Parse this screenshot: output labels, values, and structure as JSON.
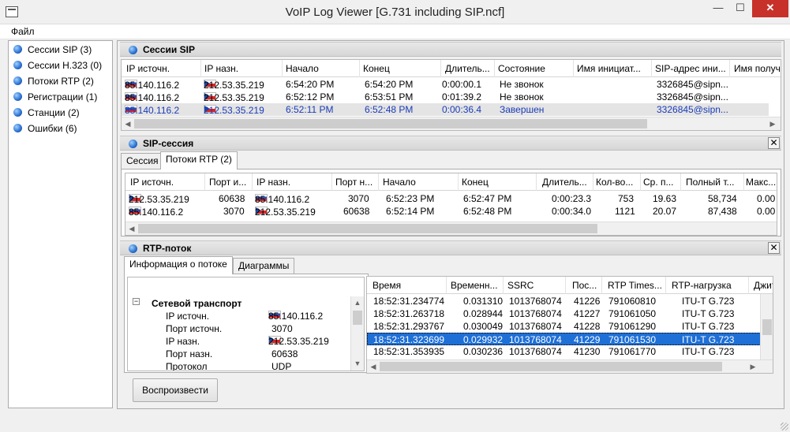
{
  "window": {
    "title": "VoIP Log Viewer [G.731 including SIP.ncf]",
    "min_glyph": "—",
    "max_glyph": "☐",
    "close_glyph": "✕"
  },
  "menu": {
    "file": "Файл"
  },
  "nav": [
    {
      "label": "Сессии SIP  (3)"
    },
    {
      "label": "Сессии H.323 (0)"
    },
    {
      "label": "Потоки RTP (2)"
    },
    {
      "label": "Регистрации (1)"
    },
    {
      "label": "Станции (2)"
    },
    {
      "label": "Ошибки (6)"
    }
  ],
  "sip_sessions": {
    "title": "Сессии SIP",
    "columns": [
      "IP источн.",
      "IP назн.",
      "Начало",
      "Конец",
      "Длитель...",
      "Состояние",
      "Имя инициат...",
      "SIP-адрес ини...",
      "Имя получ"
    ],
    "rows": [
      {
        "src": "85.140.116.2",
        "dst": "212.53.35.219",
        "start": "6:54:20 PM",
        "end": "6:54:20 PM",
        "dur": "0:00:00.1",
        "state": "Не звонок",
        "name": "",
        "sip": "3326845@sipn..."
      },
      {
        "src": "85.140.116.2",
        "dst": "212.53.35.219",
        "start": "6:52:12 PM",
        "end": "6:53:51 PM",
        "dur": "0:01:39.2",
        "state": "Не звонок",
        "name": "",
        "sip": "3326845@sipn..."
      },
      {
        "src": "85.140.116.2",
        "dst": "212.53.35.219",
        "start": "6:52:11 PM",
        "end": "6:52:48 PM",
        "dur": "0:00:36.4",
        "state": "Завершен",
        "name": "",
        "sip": "3326845@sipn..."
      }
    ]
  },
  "sip_session": {
    "title": "SIP-сессия",
    "tabs": [
      "Сессия",
      "Потоки RTP (2)"
    ],
    "columns": [
      "IP источн.",
      "Порт и...",
      "IP назн.",
      "Порт н...",
      "Начало",
      "Конец",
      "Длитель...",
      "Кол-во...",
      "Ср. п...",
      "Полный т...",
      "Макс..."
    ],
    "rows": [
      {
        "src": "212.53.35.219",
        "sport": "60638",
        "dst": "85.140.116.2",
        "dport": "3070",
        "start": "6:52:23 PM",
        "end": "6:52:47 PM",
        "dur": "0:00:23.3",
        "count": "753",
        "avg": "19.63",
        "total": "58,734",
        "max": "0.00"
      },
      {
        "src": "85.140.116.2",
        "sport": "3070",
        "dst": "212.53.35.219",
        "dport": "60638",
        "start": "6:52:14 PM",
        "end": "6:52:48 PM",
        "dur": "0:00:34.0",
        "count": "1121",
        "avg": "20.07",
        "total": "87,438",
        "max": "0.00"
      }
    ]
  },
  "rtp_stream": {
    "title": "RTP-поток",
    "tabs": [
      "Информация о потоке",
      "Диаграммы"
    ],
    "tree": {
      "group": "Сетевой транспорт",
      "items": [
        {
          "label": "IP источн.",
          "value": "85.140.116.2"
        },
        {
          "label": "Порт источн.",
          "value": "3070"
        },
        {
          "label": "IP назн.",
          "value": "212.53.35.219"
        },
        {
          "label": "Порт назн.",
          "value": "60638"
        },
        {
          "label": "Протокол",
          "value": "UDP"
        }
      ]
    },
    "packets": {
      "columns": [
        "Время",
        "Временн...",
        "SSRC",
        "Пос...",
        "RTP Times...",
        "RTP-нагрузка",
        "Джит"
      ],
      "rows": [
        {
          "time": "18:52:31.234774",
          "delta": "0.031310",
          "ssrc": "1013768074",
          "seq": "41226",
          "ts": "791060810",
          "payload": "ITU-T G.723"
        },
        {
          "time": "18:52:31.263718",
          "delta": "0.028944",
          "ssrc": "1013768074",
          "seq": "41227",
          "ts": "791061050",
          "payload": "ITU-T G.723"
        },
        {
          "time": "18:52:31.293767",
          "delta": "0.030049",
          "ssrc": "1013768074",
          "seq": "41228",
          "ts": "791061290",
          "payload": "ITU-T G.723"
        },
        {
          "time": "18:52:31.323699",
          "delta": "0.029932",
          "ssrc": "1013768074",
          "seq": "41229",
          "ts": "791061530",
          "payload": "ITU-T G.723"
        },
        {
          "time": "18:52:31.353935",
          "delta": "0.030236",
          "ssrc": "1013768074",
          "seq": "41230",
          "ts": "791061770",
          "payload": "ITU-T G.723"
        }
      ]
    },
    "play_label": "Воспроизвести"
  },
  "colors": {
    "selected_text": "#1a3cb8",
    "highlight": "#1e6fd6",
    "close_red": "#c7312a"
  }
}
